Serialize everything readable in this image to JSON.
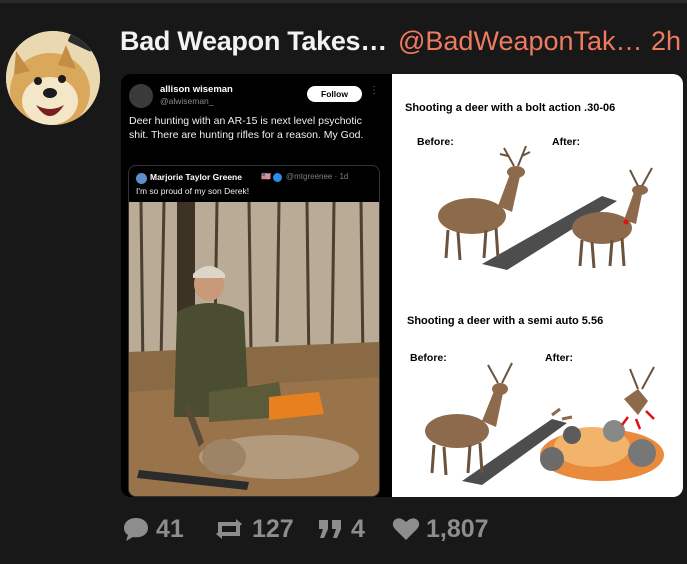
{
  "post": {
    "author_name": "Bad Weapon Takes…",
    "author_handle": "@BadWeaponTak…",
    "timestamp": "2h"
  },
  "embedded_tweet": {
    "name": "allison wiseman",
    "handle": "@alwiseman_",
    "follow_label": "Follow",
    "more": "⋮",
    "text": "Deer hunting with an AR-15 is next level psychotic shit. There are hunting rifles for a reason. My God.",
    "quote": {
      "name": "Marjorie Taylor Greene",
      "flag": "🇺🇸",
      "handle": "@mtgreenee · 1d",
      "text": "I'm so proud of my son Derek!"
    }
  },
  "meme": {
    "title1": "Shooting a deer with a bolt action .30-06",
    "before1": "Before:",
    "after1": "After:",
    "title2": "Shooting a deer with a semi auto 5.56",
    "before2": "Before:",
    "after2": "After:"
  },
  "actions": {
    "replies": "41",
    "reposts": "127",
    "quotes": "4",
    "likes": "1,807"
  },
  "colors": {
    "background": "#181818",
    "accent": "#ef7a5f",
    "muted": "#8d8d8d"
  },
  "icons": [
    "reply-icon",
    "repost-icon",
    "quote-icon",
    "like-icon"
  ]
}
